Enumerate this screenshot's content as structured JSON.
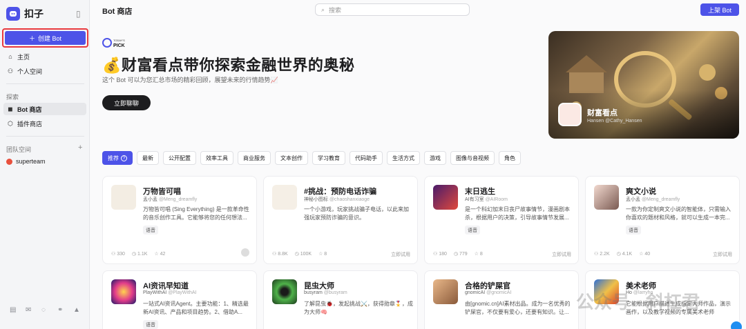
{
  "brand": {
    "name": "扣子"
  },
  "sidebar": {
    "create_label": "创建 Bot",
    "nav": [
      {
        "label": "主页",
        "icon": "home-icon"
      },
      {
        "label": "个人空间",
        "icon": "user-icon"
      }
    ],
    "explore_label": "探索",
    "explore_items": [
      {
        "label": "Bot 商店",
        "icon": "bot-icon"
      },
      {
        "label": "插件商店",
        "icon": "plugin-icon"
      }
    ],
    "team_label": "团队空间",
    "team_items": [
      {
        "label": "superteam"
      }
    ]
  },
  "header": {
    "title": "Bot 商店",
    "search_placeholder": "搜索",
    "publish_label": "上架 Bot"
  },
  "hero": {
    "badge_text": "TODAY'S PICK",
    "title": "💰财富看点带你探索金融世界的奥秘",
    "description": "这个 Bot 可以为您汇总市场的精彩回顾，展望未来的行情趋势📈",
    "button_label": "立即聊聊",
    "card_title": "财富看点",
    "card_author": "Hansen @Cathy_Hansen"
  },
  "filters": [
    {
      "label": "推荐",
      "active": true
    },
    {
      "label": "最新"
    },
    {
      "label": "公开配置"
    },
    {
      "label": "效率工具"
    },
    {
      "label": "商业服务"
    },
    {
      "label": "文本创作"
    },
    {
      "label": "学习教育"
    },
    {
      "label": "代码助手"
    },
    {
      "label": "生活方式"
    },
    {
      "label": "游戏"
    },
    {
      "label": "图像与音视频"
    },
    {
      "label": "角色"
    }
  ],
  "cards": [
    {
      "name": "万物皆可唱",
      "author": "孟小孟",
      "handle": "@Meng_dreamfly",
      "desc": "万物皆可唱 (Sing Everything) 是一款革命性的音乐创作工具。它能够将您的任何想法...",
      "tag": "语音",
      "users": "330",
      "chats": "1.1K",
      "stars": "42",
      "try": ""
    },
    {
      "name": "#挑战：预防电话诈骗",
      "author": "神秘小图标",
      "handle": "@chaoshanxiaoge",
      "desc": "一个小游戏，玩家挑战骗子电话，以此来加强玩家预防诈骗的意识。",
      "tag": "",
      "users": "8.8K",
      "chats": "100K",
      "stars": "8",
      "try": "立即试用"
    },
    {
      "name": "末日逃生",
      "author": "AI有习室",
      "handle": "@AIRoom",
      "desc": "是一个科幻加末日丧尸故事情节，漫画剧本杀，根据用户的决策，引导故事情节发展...",
      "tag": "语音",
      "users": "180",
      "chats": "779",
      "stars": "8",
      "try": "立即试用"
    },
    {
      "name": "爽文小说",
      "author": "孟小孟",
      "handle": "@Meng_dreamfly",
      "desc": "一款为你定制爽文小说的智能体，只需输入你喜欢的题材和风格，就可以生成一本完...",
      "tag": "语音",
      "users": "2.2K",
      "chats": "4.1K",
      "stars": "40",
      "try": "立即试用"
    },
    {
      "name": "AI资讯早知道",
      "author": "PlayWithAI",
      "handle": "@PlayWithAI",
      "desc": "一站式AI资讯Agent。主要功能：1、精选最新AI资讯、产品和项目趋势。2、借助A...",
      "tag": "语音",
      "users": "",
      "chats": "",
      "stars": "",
      "try": ""
    },
    {
      "name": "昆虫大师",
      "author": "busyram",
      "handle": "@busyram",
      "desc": "了解昆虫🐞，发起挑战⚔️，获得勋章🎖️，成为大师🧠",
      "tag": "",
      "users": "",
      "chats": "",
      "stars": "",
      "try": ""
    },
    {
      "name": "合格的铲屎官",
      "author": "gnomicAI",
      "handle": "@gnomicAI",
      "desc": "由[gnomic.cn]AI素材出品。成为一名优秀的铲屎官，不仅要有爱心，还要有知识。让...",
      "tag": "",
      "users": "",
      "chats": "",
      "stars": "",
      "try": ""
    },
    {
      "name": "美术老师",
      "author": "Ho",
      "handle": "@larryho",
      "desc": "它能根据用户描述生成指定大师作品，演示画作，以及教学视频的专属美术老师",
      "tag": "",
      "users": "",
      "chats": "",
      "stars": "",
      "try": ""
    }
  ],
  "watermark": "公众号 · 斜杠君"
}
